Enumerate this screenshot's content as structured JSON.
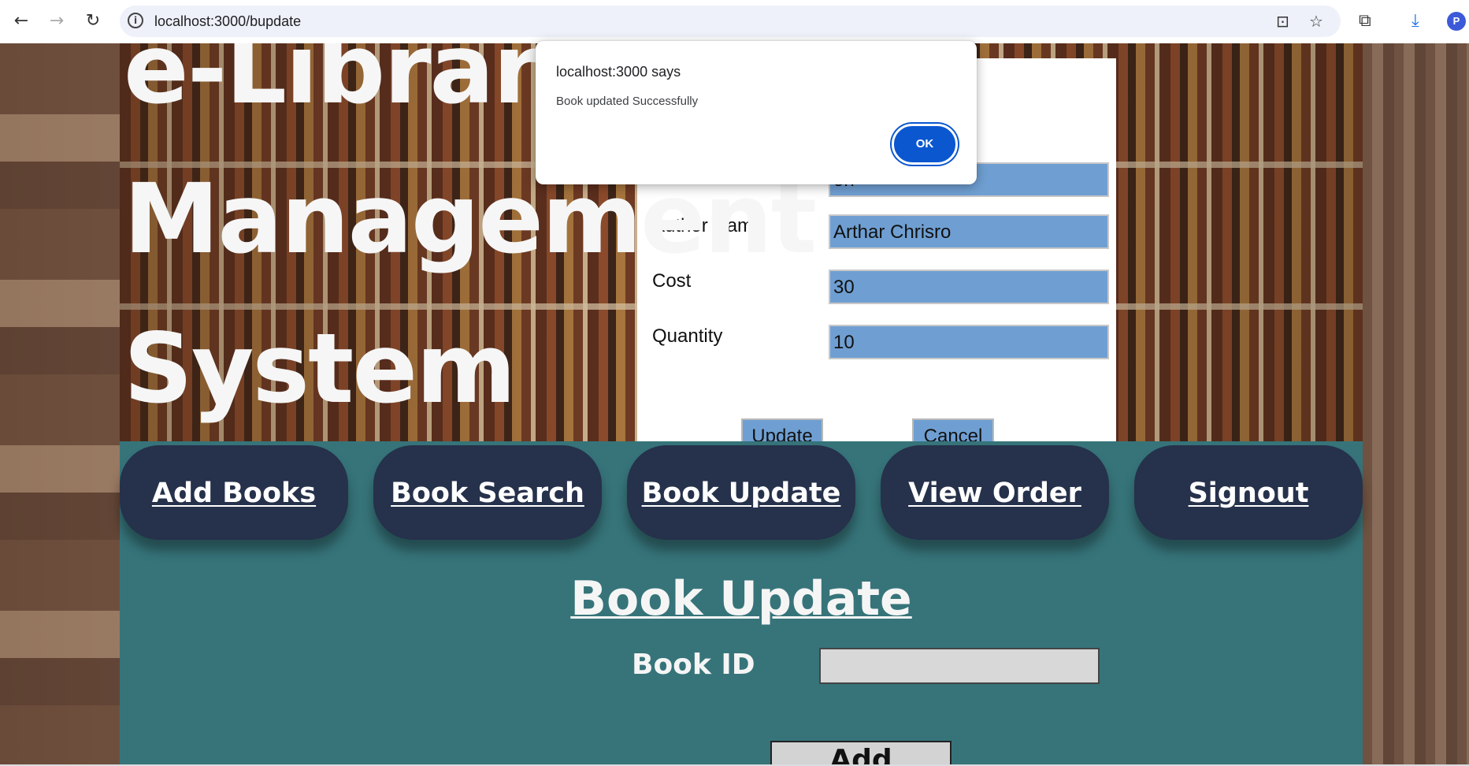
{
  "browser": {
    "url": "localhost:3000/bupdate",
    "profile_initial": "P",
    "icons": {
      "back": "←",
      "forward": "→",
      "reload": "↻",
      "site_info": "i",
      "install": "⊡",
      "bookmark": "☆",
      "extensions": "⧉",
      "download": "⤓"
    }
  },
  "banner": {
    "title_lines": [
      "e-Library",
      "Management",
      "System"
    ]
  },
  "update_form": {
    "fields": [
      {
        "label": "",
        "value": "on"
      },
      {
        "label": "Author Name",
        "value": "Arthar Chrisro"
      },
      {
        "label": "Cost",
        "value": "30"
      },
      {
        "label": "Quantity",
        "value": "10"
      }
    ],
    "update_label": "Update",
    "cancel_label": "Cancel"
  },
  "nav": {
    "items": [
      "Add Books",
      "Book Search",
      "Book Update",
      "View Order",
      "Signout"
    ]
  },
  "section": {
    "title": "Book Update",
    "book_id_label": "Book ID",
    "book_id_value": "",
    "add_label": "Add"
  },
  "dialog": {
    "title": "localhost:3000 says",
    "message": "Book updated Successfully",
    "ok_label": "OK"
  },
  "colors": {
    "nav_bg": "#36747a",
    "nav_button": "#26314b",
    "form_input": "#6f9fd2",
    "dialog_ok": "#0b57d0"
  }
}
